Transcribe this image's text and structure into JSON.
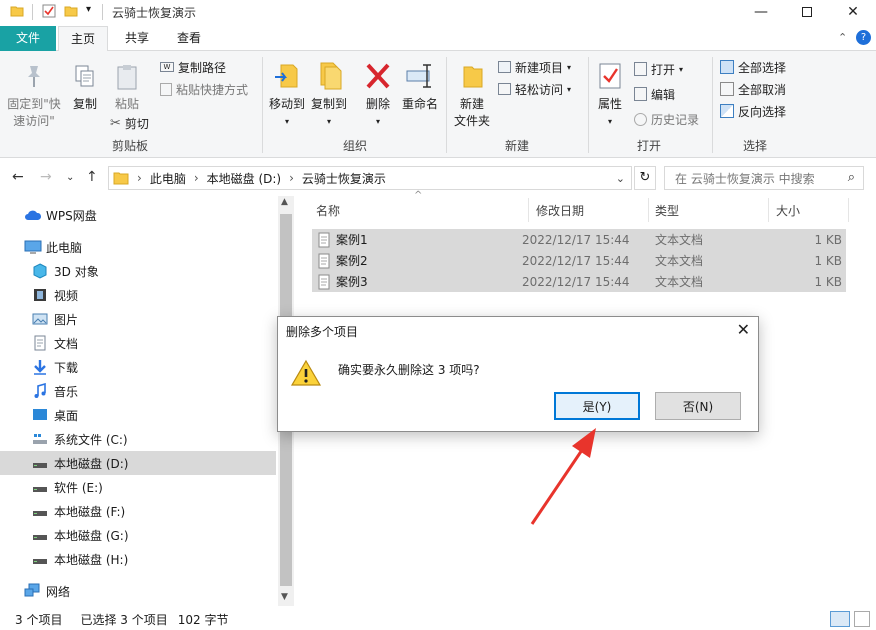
{
  "window": {
    "title": "云骑士恢复演示"
  },
  "tabs": {
    "file": "文件",
    "home": "主页",
    "share": "共享",
    "view": "查看"
  },
  "ribbon": {
    "clipboard": {
      "label": "剪贴板",
      "pin": "固定到\"快\n速访问\"",
      "copy": "复制",
      "paste": "粘贴",
      "copy_path": "复制路径",
      "paste_shortcut": "粘贴快捷方式",
      "cut": "剪切"
    },
    "organize": {
      "label": "组织",
      "move_to": "移动到",
      "copy_to": "复制到",
      "delete": "删除",
      "rename": "重命名"
    },
    "new": {
      "label": "新建",
      "new_folder": "新建\n文件夹",
      "new_item": "新建项目",
      "easy_access": "轻松访问"
    },
    "open": {
      "label": "打开",
      "properties": "属性",
      "open": "打开",
      "edit": "编辑",
      "history": "历史记录"
    },
    "select": {
      "label": "选择",
      "select_all": "全部选择",
      "select_none": "全部取消",
      "invert": "反向选择"
    }
  },
  "address": {
    "segments": [
      "此电脑",
      "本地磁盘 (D:)",
      "云骑士恢复演示"
    ],
    "search_placeholder": "在 云骑士恢复演示 中搜索"
  },
  "nav": {
    "items": [
      {
        "label": "WPS网盘"
      },
      {
        "label": "此电脑"
      },
      {
        "label": "3D 对象"
      },
      {
        "label": "视频"
      },
      {
        "label": "图片"
      },
      {
        "label": "文档"
      },
      {
        "label": "下载"
      },
      {
        "label": "音乐"
      },
      {
        "label": "桌面"
      },
      {
        "label": "系统文件 (C:)"
      },
      {
        "label": "本地磁盘 (D:)"
      },
      {
        "label": "软件 (E:)"
      },
      {
        "label": "本地磁盘 (F:)"
      },
      {
        "label": "本地磁盘 (G:)"
      },
      {
        "label": "本地磁盘 (H:)"
      },
      {
        "label": "网络"
      }
    ]
  },
  "list": {
    "columns": {
      "name": "名称",
      "modified": "修改日期",
      "type": "类型",
      "size": "大小"
    },
    "files": [
      {
        "name": "案例1",
        "modified": "2022/12/17 15:44",
        "type": "文本文档",
        "size": "1 KB"
      },
      {
        "name": "案例2",
        "modified": "2022/12/17 15:44",
        "type": "文本文档",
        "size": "1 KB"
      },
      {
        "name": "案例3",
        "modified": "2022/12/17 15:44",
        "type": "文本文档",
        "size": "1 KB"
      }
    ]
  },
  "status": {
    "count": "3 个项目",
    "selected": "已选择 3 个项目",
    "size": "102 字节"
  },
  "dialog": {
    "title": "删除多个项目",
    "message": "确实要永久删除这 3 项吗?",
    "yes": "是(Y)",
    "no": "否(N)"
  },
  "colors": {
    "accent": "#19a2a4",
    "folder": "#f7c948",
    "arrow": "#e8342c"
  }
}
